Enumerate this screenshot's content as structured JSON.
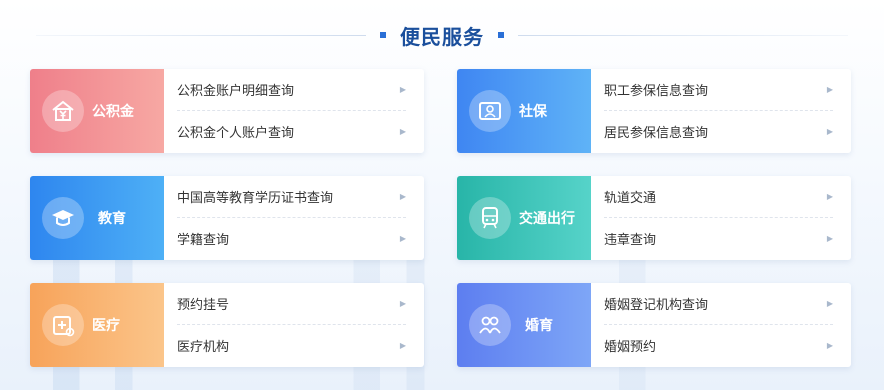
{
  "section": {
    "title": "便民服务"
  },
  "cards": [
    {
      "category": "公积金",
      "icon": "house-yen-icon",
      "color": "#ef7f8a",
      "items": [
        {
          "label": "公积金账户明细查询"
        },
        {
          "label": "公积金个人账户查询"
        }
      ]
    },
    {
      "category": "社保",
      "icon": "id-card-icon",
      "color": "#3f86f2",
      "items": [
        {
          "label": "职工参保信息查询"
        },
        {
          "label": "居民参保信息查询"
        }
      ]
    },
    {
      "category": "教育",
      "icon": "graduation-cap-icon",
      "color": "#2e86ef",
      "items": [
        {
          "label": "中国高等教育学历证书查询"
        },
        {
          "label": "学籍查询"
        }
      ]
    },
    {
      "category": "交通出行",
      "icon": "train-icon",
      "color": "#28b5a8",
      "items": [
        {
          "label": "轨道交通"
        },
        {
          "label": "违章查询"
        }
      ]
    },
    {
      "category": "医疗",
      "icon": "medical-kit-icon",
      "color": "#f7a35a",
      "items": [
        {
          "label": "预约挂号"
        },
        {
          "label": "医疗机构"
        }
      ]
    },
    {
      "category": "婚育",
      "icon": "people-icon",
      "color": "#5d7ef0",
      "items": [
        {
          "label": "婚姻登记机构查询"
        },
        {
          "label": "婚姻预约"
        }
      ]
    }
  ]
}
